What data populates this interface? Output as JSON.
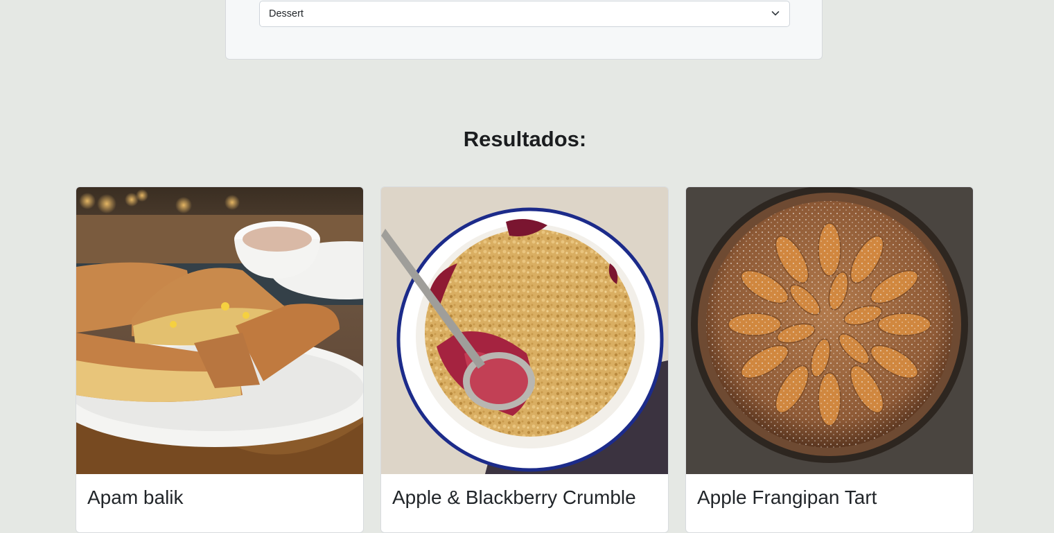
{
  "filter": {
    "category_select": {
      "selected": "Dessert"
    }
  },
  "results": {
    "title": "Resultados:",
    "items": [
      {
        "name": "Apam balik",
        "image": "apam-balik-photo"
      },
      {
        "name": "Apple & Blackberry Crumble",
        "image": "crumble-photo"
      },
      {
        "name": "Apple Frangipan Tart",
        "image": "frangipan-tart-photo"
      }
    ]
  },
  "colors": {
    "page_background": "#e5e8e4",
    "panel_background": "#f6f8f9",
    "card_background": "#ffffff"
  }
}
